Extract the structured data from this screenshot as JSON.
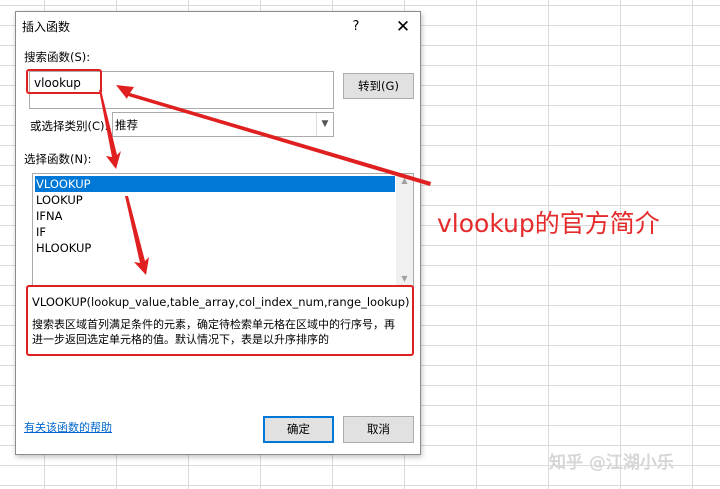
{
  "dialog": {
    "title": "插入函数",
    "help_glyph": "?",
    "close_glyph": "✕",
    "search_label": "搜索函数(S):",
    "search_value": "vlookup",
    "goto_button": "转到(G)",
    "category_label": "或选择类别(C):",
    "category_value": "推荐",
    "select_function_label": "选择函数(N):",
    "functions": [
      "VLOOKUP",
      "LOOKUP",
      "IFNA",
      "IF",
      "HLOOKUP"
    ],
    "selected_index": 0,
    "syntax": "VLOOKUP(lookup_value,table_array,col_index_num,range_lookup)",
    "description_line1": "搜索表区域首列满足条件的元素，确定待检索单元格在区域中的行序号，再",
    "description_line2": "进一步返回选定单元格的值。默认情况下，表是以升序排序的",
    "help_link": "有关该函数的帮助",
    "ok_button": "确定",
    "cancel_button": "取消"
  },
  "annotation": {
    "text": "vlookup的官方简介",
    "color": "#e52b2b"
  },
  "watermark": "知乎 @江湖小乐",
  "colors": {
    "selection": "#0078d7",
    "highlight_box": "#e02020",
    "link": "#0066cc"
  }
}
